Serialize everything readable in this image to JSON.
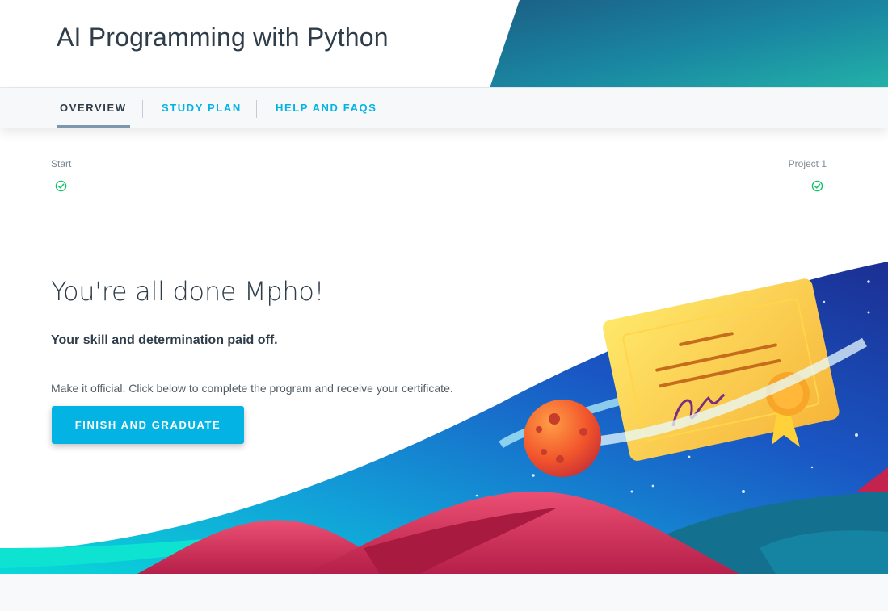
{
  "header": {
    "title": "AI Programming with Python"
  },
  "tabs": [
    {
      "label": "OVERVIEW",
      "active": true
    },
    {
      "label": "STUDY PLAN",
      "active": false
    },
    {
      "label": "HELP AND FAQS",
      "active": false
    }
  ],
  "progress": {
    "start_label": "Start",
    "end_label": "Project 1",
    "start_complete": true,
    "end_complete": true
  },
  "completion": {
    "title": "You're all done Mpho!",
    "subtitle": "Your skill and determination paid off.",
    "description": "Make it official. Click below to complete the program and receive your certificate.",
    "button_label": "FINISH AND GRADUATE"
  },
  "colors": {
    "accent": "#02b3e4",
    "text": "#2e3d49",
    "check": "#15c26b"
  }
}
